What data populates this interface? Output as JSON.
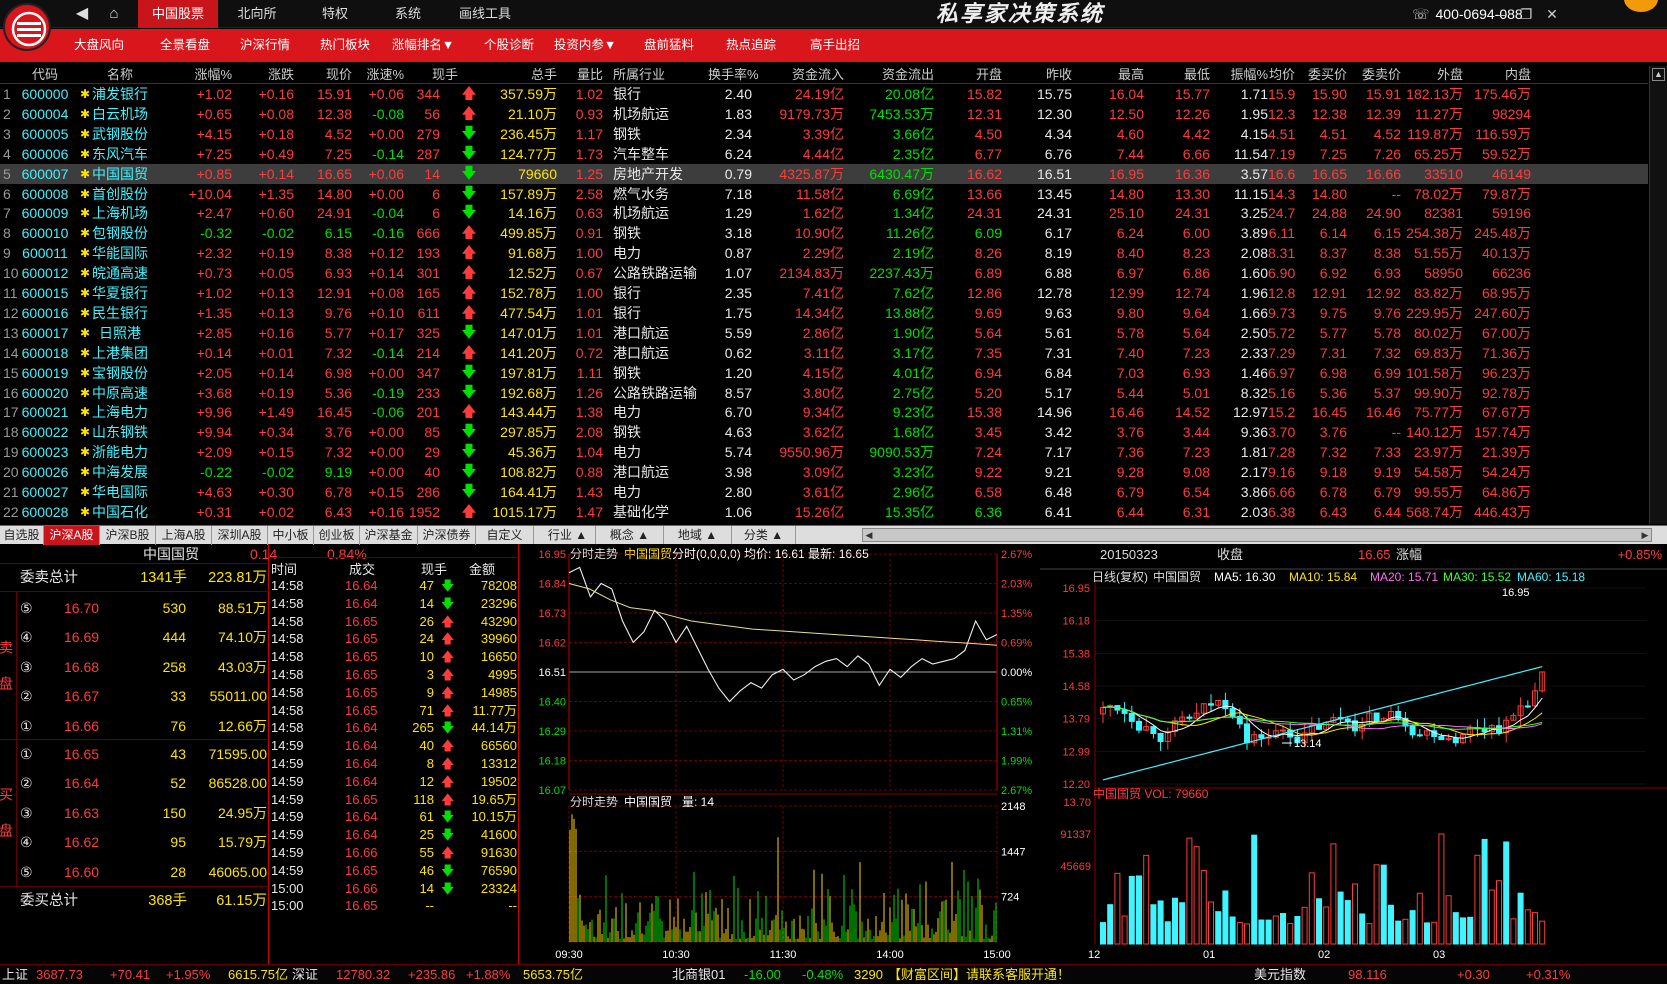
{
  "app": {
    "title": "私享家决策系统",
    "hotline": "400-0694-088"
  },
  "topnav": [
    {
      "label": "中国股票",
      "active": true
    },
    {
      "label": "北向所"
    },
    {
      "label": "特权"
    },
    {
      "label": "系统"
    },
    {
      "label": "画线工具"
    }
  ],
  "menu": [
    "大盘风向",
    "全景看盘",
    "沪深行情",
    "热门板块",
    "涨幅排名▼",
    "个股诊断",
    "投资内参▼",
    "盘前猛料",
    "热点追踪",
    "高手出招"
  ],
  "grid": {
    "columns": [
      "代码",
      "名称",
      "涨幅%",
      "涨跌",
      "现价",
      "涨速%",
      "现手",
      "总手",
      "量比",
      "所属行业",
      "换手率%",
      "资金流入",
      "资金流出",
      "开盘",
      "昨收",
      "最高",
      "最低",
      "振幅%",
      "均价",
      "委买价",
      "委卖价",
      "外盘",
      "内盘"
    ],
    "rows": [
      [
        "1",
        "600000",
        "浦发银行",
        "+1.02",
        "+0.16",
        "15.91",
        "+0.06",
        "344",
        "up",
        "357.59万",
        "1.02",
        "银行",
        "2.40",
        "24.19亿",
        "20.08亿",
        "15.82",
        "15.75",
        "16.04",
        "15.77",
        "1.71",
        "15.92",
        "15.90",
        "15.91",
        "182.13万",
        "175.46万"
      ],
      [
        "2",
        "600004",
        "白云机场",
        "+0.65",
        "+0.08",
        "12.38",
        "-0.08",
        "56",
        "up",
        "21.10万",
        "0.93",
        "机场航运",
        "1.83",
        "9179.73万",
        "7453.53万",
        "12.31",
        "12.30",
        "12.50",
        "12.26",
        "1.95",
        "12.37",
        "12.38",
        "12.39",
        "11.27万",
        "98294"
      ],
      [
        "3",
        "600005",
        "武钢股份",
        "+4.15",
        "+0.18",
        "4.52",
        "+0.00",
        "279",
        "dn",
        "236.45万",
        "1.17",
        "钢铁",
        "2.34",
        "3.39亿",
        "3.66亿",
        "4.50",
        "4.34",
        "4.60",
        "4.42",
        "4.15",
        "4.51",
        "4.51",
        "4.52",
        "119.87万",
        "116.59万"
      ],
      [
        "4",
        "600006",
        "东风汽车",
        "+7.25",
        "+0.49",
        "7.25",
        "-0.14",
        "287",
        "dn",
        "124.77万",
        "1.73",
        "汽车整车",
        "6.24",
        "4.44亿",
        "2.35亿",
        "6.77",
        "6.76",
        "7.44",
        "6.66",
        "11.54",
        "7.19",
        "7.25",
        "7.26",
        "65.25万",
        "59.52万"
      ],
      [
        "5",
        "600007",
        "中国国贸",
        "+0.85",
        "+0.14",
        "16.65",
        "+0.06",
        "14",
        "dn",
        "79660",
        "1.25",
        "房地产开发",
        "0.79",
        "4325.87万",
        "6430.47万",
        "16.62",
        "16.51",
        "16.95",
        "16.36",
        "3.57",
        "16.61",
        "16.65",
        "16.66",
        "33510",
        "46149"
      ],
      [
        "6",
        "600008",
        "首创股份",
        "+10.04",
        "+1.35",
        "14.80",
        "+0.00",
        "6",
        "dn",
        "157.89万",
        "2.58",
        "燃气水务",
        "7.18",
        "11.58亿",
        "6.69亿",
        "13.66",
        "13.45",
        "14.80",
        "13.30",
        "11.15",
        "14.30",
        "14.80",
        "--",
        "78.02万",
        "79.87万"
      ],
      [
        "7",
        "600009",
        "上海机场",
        "+2.47",
        "+0.60",
        "24.91",
        "-0.04",
        "6",
        "dn",
        "14.16万",
        "0.63",
        "机场航运",
        "1.29",
        "1.62亿",
        "1.34亿",
        "24.31",
        "24.31",
        "25.10",
        "24.31",
        "3.25",
        "24.79",
        "24.88",
        "24.90",
        "82381",
        "59196"
      ],
      [
        "8",
        "600010",
        "包钢股份",
        "-0.32",
        "-0.02",
        "6.15",
        "-0.16",
        "666",
        "up",
        "499.85万",
        "0.91",
        "钢铁",
        "3.18",
        "10.90亿",
        "11.26亿",
        "6.09",
        "6.17",
        "6.24",
        "6.00",
        "3.89",
        "6.11",
        "6.14",
        "6.15",
        "254.38万",
        "245.48万"
      ],
      [
        "9",
        "600011",
        "华能国际",
        "+2.32",
        "+0.19",
        "8.38",
        "+0.12",
        "193",
        "up",
        "91.68万",
        "1.00",
        "电力",
        "0.87",
        "2.29亿",
        "2.19亿",
        "8.26",
        "8.19",
        "8.40",
        "8.23",
        "2.08",
        "8.31",
        "8.37",
        "8.38",
        "51.55万",
        "40.13万"
      ],
      [
        "10",
        "600012",
        "皖通高速",
        "+0.73",
        "+0.05",
        "6.93",
        "+0.14",
        "301",
        "up",
        "12.52万",
        "0.67",
        "公路铁路运输",
        "1.07",
        "2134.83万",
        "2237.43万",
        "6.89",
        "6.88",
        "6.97",
        "6.86",
        "1.60",
        "6.90",
        "6.92",
        "6.93",
        "58950",
        "66236"
      ],
      [
        "11",
        "600015",
        "华夏银行",
        "+1.02",
        "+0.13",
        "12.91",
        "+0.08",
        "165",
        "up",
        "152.78万",
        "1.00",
        "银行",
        "2.35",
        "7.41亿",
        "7.62亿",
        "12.86",
        "12.78",
        "12.99",
        "12.74",
        "1.96",
        "12.88",
        "12.91",
        "12.92",
        "83.82万",
        "68.95万"
      ],
      [
        "12",
        "600016",
        "民生银行",
        "+1.35",
        "+0.13",
        "9.76",
        "+0.10",
        "611",
        "up",
        "477.54万",
        "1.01",
        "银行",
        "1.75",
        "14.34亿",
        "13.88亿",
        "9.69",
        "9.63",
        "9.80",
        "9.64",
        "1.66",
        "9.73",
        "9.75",
        "9.76",
        "229.95万",
        "247.60万"
      ],
      [
        "13",
        "600017",
        "日照港",
        "+2.85",
        "+0.16",
        "5.77",
        "+0.17",
        "325",
        "dn",
        "147.01万",
        "1.01",
        "港口航运",
        "5.59",
        "2.86亿",
        "1.90亿",
        "5.64",
        "5.61",
        "5.78",
        "5.64",
        "2.50",
        "5.72",
        "5.77",
        "5.78",
        "80.02万",
        "67.00万"
      ],
      [
        "14",
        "600018",
        "上港集团",
        "+0.14",
        "+0.01",
        "7.32",
        "-0.14",
        "214",
        "up",
        "141.20万",
        "0.72",
        "港口航运",
        "0.62",
        "3.11亿",
        "3.17亿",
        "7.35",
        "7.31",
        "7.40",
        "7.23",
        "2.33",
        "7.29",
        "7.31",
        "7.32",
        "69.83万",
        "71.36万"
      ],
      [
        "15",
        "600019",
        "宝钢股份",
        "+2.05",
        "+0.14",
        "6.98",
        "+0.00",
        "347",
        "dn",
        "197.81万",
        "1.11",
        "钢铁",
        "1.20",
        "4.15亿",
        "4.01亿",
        "6.94",
        "6.84",
        "7.03",
        "6.93",
        "1.46",
        "6.97",
        "6.98",
        "6.99",
        "101.58万",
        "96.23万"
      ],
      [
        "16",
        "600020",
        "中原高速",
        "+3.68",
        "+0.19",
        "5.36",
        "-0.19",
        "233",
        "dn",
        "192.68万",
        "1.26",
        "公路铁路运输",
        "8.57",
        "3.80亿",
        "2.75亿",
        "5.20",
        "5.17",
        "5.44",
        "5.01",
        "8.32",
        "5.16",
        "5.36",
        "5.37",
        "99.90万",
        "92.78万"
      ],
      [
        "17",
        "600021",
        "上海电力",
        "+9.96",
        "+1.49",
        "16.45",
        "-0.06",
        "201",
        "up",
        "143.44万",
        "1.38",
        "电力",
        "6.70",
        "9.34亿",
        "9.23亿",
        "15.38",
        "14.96",
        "16.46",
        "14.52",
        "12.97",
        "15.29",
        "16.45",
        "16.46",
        "75.77万",
        "67.67万"
      ],
      [
        "18",
        "600022",
        "山东钢铁",
        "+9.94",
        "+0.34",
        "3.76",
        "+0.00",
        "85",
        "dn",
        "297.85万",
        "2.08",
        "钢铁",
        "4.63",
        "3.62亿",
        "1.68亿",
        "3.45",
        "3.42",
        "3.76",
        "3.44",
        "9.36",
        "3.70",
        "3.76",
        "--",
        "140.12万",
        "157.74万"
      ],
      [
        "19",
        "600023",
        "浙能电力",
        "+2.09",
        "+0.15",
        "7.32",
        "+0.00",
        "29",
        "dn",
        "45.36万",
        "1.04",
        "电力",
        "5.74",
        "9550.96万",
        "9090.53万",
        "7.24",
        "7.17",
        "7.36",
        "7.23",
        "1.81",
        "7.28",
        "7.32",
        "7.33",
        "23.97万",
        "21.39万"
      ],
      [
        "20",
        "600026",
        "中海发展",
        "-0.22",
        "-0.02",
        "9.19",
        "+0.00",
        "40",
        "dn",
        "108.82万",
        "0.88",
        "港口航运",
        "3.98",
        "3.09亿",
        "3.23亿",
        "9.22",
        "9.21",
        "9.28",
        "9.08",
        "2.17",
        "9.16",
        "9.18",
        "9.19",
        "54.58万",
        "54.24万"
      ],
      [
        "21",
        "600027",
        "华电国际",
        "+4.63",
        "+0.30",
        "6.78",
        "+0.15",
        "286",
        "dn",
        "164.41万",
        "1.43",
        "电力",
        "2.80",
        "3.61亿",
        "2.96亿",
        "6.58",
        "6.48",
        "6.79",
        "6.54",
        "3.86",
        "6.66",
        "6.78",
        "6.79",
        "99.55万",
        "64.86万"
      ],
      [
        "22",
        "600028",
        "中国石化",
        "+0.31",
        "+0.02",
        "6.43",
        "+0.16",
        "1952",
        "up",
        "1015.17万",
        "1.47",
        "基础化学",
        "1.06",
        "15.26亿",
        "15.35亿",
        "6.36",
        "6.41",
        "6.44",
        "6.31",
        "2.03",
        "6.38",
        "6.43",
        "6.44",
        "568.74万",
        "446.43万"
      ]
    ]
  },
  "tabs": [
    "自选股",
    "沪深A股",
    "沪深B股",
    "上海A股",
    "深圳A股",
    "中小板",
    "创业板",
    "沪深基金",
    "沪深债券",
    "自定义",
    "行业 ▲",
    "概念 ▲",
    "地域 ▲",
    "分类 ▲"
  ],
  "orderbook": {
    "name": "中国国贸",
    "price": "0.14",
    "pct": "0.84%",
    "sell_total_label": "委卖总计",
    "sell_total_vol": "1341手",
    "sell_total_amt": "223.81万",
    "sell_side": "卖盘",
    "buy_side": "买盘",
    "buy_total_label": "委买总计",
    "buy_total_vol": "368手",
    "buy_total_amt": "61.15万",
    "sells": [
      [
        "⑤",
        "16.70",
        "530",
        "88.51万"
      ],
      [
        "④",
        "16.69",
        "444",
        "74.10万"
      ],
      [
        "③",
        "16.68",
        "258",
        "43.03万"
      ],
      [
        "②",
        "16.67",
        "33",
        "55011.00"
      ],
      [
        "①",
        "16.66",
        "76",
        "12.66万"
      ]
    ],
    "buys": [
      [
        "①",
        "16.65",
        "43",
        "71595.00"
      ],
      [
        "②",
        "16.64",
        "52",
        "86528.00"
      ],
      [
        "③",
        "16.63",
        "150",
        "24.95万"
      ],
      [
        "④",
        "16.62",
        "95",
        "15.79万"
      ],
      [
        "⑤",
        "16.60",
        "28",
        "46065.00"
      ]
    ]
  },
  "trades": {
    "headers": [
      "时间",
      "成交",
      "现手",
      "金额"
    ],
    "rows": [
      [
        "14:58",
        "16.64",
        "47",
        "dn",
        "78208"
      ],
      [
        "14:58",
        "16.64",
        "14",
        "dn",
        "23296"
      ],
      [
        "14:58",
        "16.65",
        "26",
        "up",
        "43290"
      ],
      [
        "14:58",
        "16.65",
        "24",
        "up",
        "39960"
      ],
      [
        "14:58",
        "16.65",
        "10",
        "up",
        "16650"
      ],
      [
        "14:58",
        "16.65",
        "3",
        "up",
        "4995"
      ],
      [
        "14:58",
        "16.65",
        "9",
        "up",
        "14985"
      ],
      [
        "14:58",
        "16.65",
        "71",
        "up",
        "11.77万"
      ],
      [
        "14:58",
        "16.64",
        "265",
        "dn",
        "44.14万"
      ],
      [
        "14:59",
        "16.64",
        "40",
        "up",
        "66560"
      ],
      [
        "14:59",
        "16.64",
        "8",
        "up",
        "13312"
      ],
      [
        "14:59",
        "16.64",
        "12",
        "up",
        "19502"
      ],
      [
        "14:59",
        "16.65",
        "118",
        "up",
        "19.65万"
      ],
      [
        "14:59",
        "16.64",
        "61",
        "dn",
        "10.15万"
      ],
      [
        "14:59",
        "16.64",
        "25",
        "dn",
        "41600"
      ],
      [
        "14:59",
        "16.66",
        "55",
        "up",
        "91630"
      ],
      [
        "14:59",
        "16.65",
        "46",
        "dn",
        "76590"
      ],
      [
        "15:00",
        "16.66",
        "14",
        "dn",
        "23324"
      ],
      [
        "15:00",
        "16.65",
        "--",
        "",
        "--"
      ]
    ]
  },
  "intraday": {
    "title": "分时走势",
    "name": "中国国贸",
    "params": "分时(0,0,0,0)",
    "avg_label": "均价: 16.61",
    "last_label": "最新: 16.65",
    "left_ticks": [
      "16.95",
      "16.84",
      "16.73",
      "16.62",
      "16.51",
      "16.40",
      "16.29",
      "16.18",
      "16.07"
    ],
    "right_ticks": [
      "2.67%",
      "2.03%",
      "1.35%",
      "0.69%",
      "0.00%",
      "0.65%",
      "1.31%",
      "1.99%",
      "2.67%"
    ],
    "vol_title": "分时走势",
    "vol_name": "中国国贸",
    "vol_label": "量: 14",
    "vol_ticks": [
      "2148",
      "1447",
      "724"
    ],
    "time_ticks": [
      "09:30",
      "10:30",
      "11:30",
      "14:00",
      "15:00"
    ]
  },
  "kline": {
    "date": "20150323",
    "close_label": "收盘",
    "close": "16.65",
    "chg_label": "涨幅",
    "chg": "+0.85%",
    "ma_title": "日线(复权)",
    "name": "中国国贸",
    "ma5": "MA5: 16.30",
    "ma10": "MA10: 15.84",
    "ma20": "MA20: 15.71",
    "ma30": "MA30: 15.52",
    "ma60": "MA60: 15.18",
    "price_ticks": [
      "16.95",
      "16.18",
      "15.38",
      "14.58",
      "13.79",
      "12.99",
      "12.20"
    ],
    "high_mark": "16.95",
    "low_mark": "13.14",
    "vol_label": "中国国贸 VOL: 79660",
    "vol_ticks": [
      "13.70",
      "91337",
      "45669"
    ],
    "month_ticks": [
      "12",
      "01",
      "02",
      "03"
    ]
  },
  "colors": {
    "up": "#ff3b3b",
    "down": "#00e000",
    "brand": "#d9161c"
  },
  "status": {
    "sh_label": "上证",
    "sh": "3687.73",
    "sh_chg": "+70.41",
    "sh_pct": "+1.95%",
    "sh_amt": "6615.75亿",
    "sz_label": "深证",
    "sz": "12780.32",
    "sz_chg": "+235.86",
    "sz_pct": "+1.88%",
    "sz_amt": "5653.75亿",
    "nb_label": "北商银01",
    "nb": "-16.00",
    "nb_pct": "-0.48%",
    "nb_vol": "3290",
    "marquee": "【财富区间】请联系客服开通！",
    "usd_label": "美元指数",
    "usd": "98.116",
    "usd_chg": "+0.30",
    "usd_pct": "+0.31%"
  }
}
